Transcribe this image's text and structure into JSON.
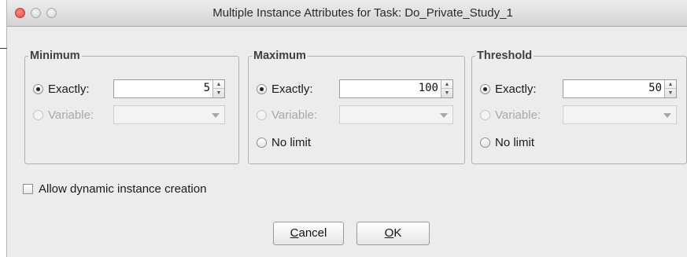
{
  "window": {
    "title": "Multiple Instance Attributes for Task: Do_Private_Study_1"
  },
  "groups": [
    {
      "legend": "Minimum",
      "exactly_label": "Exactly:",
      "exactly_value": "5",
      "variable_label": "Variable:",
      "variable_value": "",
      "selected": "exactly"
    },
    {
      "legend": "Maximum",
      "exactly_label": "Exactly:",
      "exactly_value": "100",
      "variable_label": "Variable:",
      "variable_value": "",
      "no_limit_label": "No limit",
      "selected": "exactly"
    },
    {
      "legend": "Threshold",
      "exactly_label": "Exactly:",
      "exactly_value": "50",
      "variable_label": "Variable:",
      "variable_value": "",
      "no_limit_label": "No limit",
      "selected": "exactly"
    }
  ],
  "options": {
    "allow_dynamic_label": "Allow dynamic instance creation",
    "allow_dynamic_checked": false
  },
  "buttons": {
    "cancel_mnemonic": "C",
    "cancel_rest": "ancel",
    "ok_mnemonic": "O",
    "ok_rest": "K"
  },
  "colors": {
    "window_bg": "#ececec",
    "close_button": "#e0443e",
    "disabled_text": "#a8a8a8"
  }
}
